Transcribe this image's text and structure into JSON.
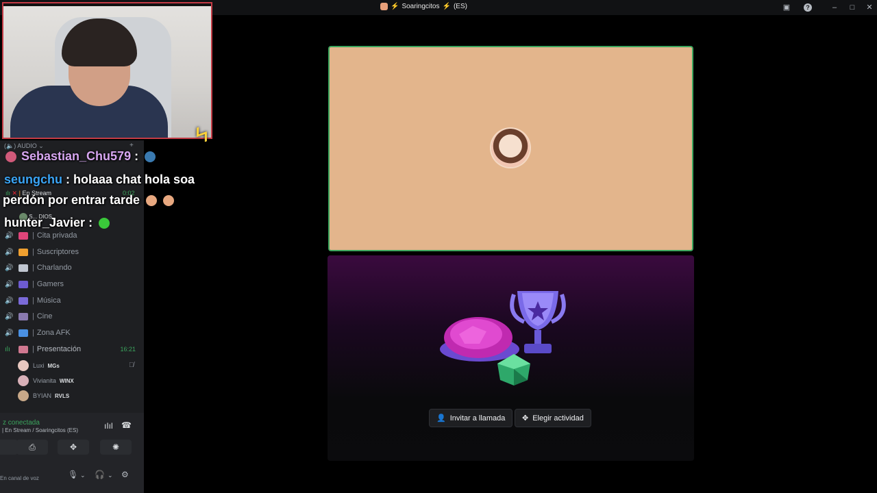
{
  "window": {
    "title": "Soaringcitos",
    "title_suffix": "(ES)",
    "controls": {
      "minimize": "–",
      "maximize": "□",
      "close": "✕"
    }
  },
  "sidebar": {
    "header": "AUDIO",
    "channels": [
      {
        "label": "Cita privada",
        "emoji_color": "#e0457a"
      },
      {
        "label": "Suscriptores",
        "emoji_color": "#f0a030"
      },
      {
        "label": "Charlando",
        "emoji_color": "#c0c6d0"
      },
      {
        "label": "Gamers",
        "emoji_color": "#6d5bd0"
      },
      {
        "label": "Música",
        "emoji_color": "#7a6ad8"
      },
      {
        "label": "Cine",
        "emoji_color": "#8a7ab0"
      },
      {
        "label": "Zona AFK",
        "emoji_color": "#4a90e2"
      },
      {
        "label": "Presentación",
        "emoji_color": "#d07890",
        "time": "16:21",
        "live": true
      }
    ],
    "users": [
      {
        "name": "Luxi",
        "tag": "MGs",
        "avatar_color": "#e8c8c0"
      },
      {
        "name": "Vivianita",
        "tag": "WINX",
        "avatar_color": "#d8b0b8"
      },
      {
        "name": "BYIAN",
        "tag": "RVLS",
        "avatar_color": "#c8a888"
      }
    ],
    "stream_row": "En Stream",
    "stream_time": "0:02",
    "dios_row": "S... DIOS"
  },
  "voice": {
    "status": "z conectada",
    "sub": "| En Stream / Soaringcitos (ES)",
    "bottom_label": "En canal de voz"
  },
  "chat": [
    {
      "user": "Sebastian_Chu579",
      "sep": " :",
      "message": ""
    },
    {
      "user": "seungchu",
      "sep": " :",
      "message": " holaaa chat hola soa"
    },
    {
      "user": "",
      "sep": "",
      "message": "perdón por entrar tarde"
    },
    {
      "user": "hunter_Javier",
      "sep": " :",
      "message": ""
    }
  ],
  "actions": {
    "invite": "Invitar a llamada",
    "activity": "Elegir actividad"
  },
  "colors": {
    "accent_green": "#3ba55d",
    "tile_bg": "#e3b58c",
    "webcam_border": "#c43b45"
  }
}
